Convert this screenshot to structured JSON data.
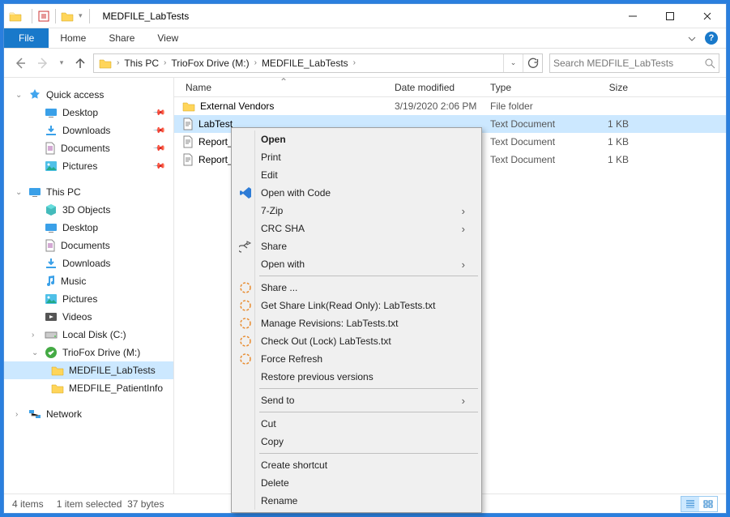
{
  "window": {
    "title": "MEDFILE_LabTests"
  },
  "ribbon": {
    "file": "File",
    "home": "Home",
    "share": "Share",
    "view": "View"
  },
  "breadcrumb": {
    "thispc": "This PC",
    "drive": "TrioFox Drive (M:)",
    "folder": "MEDFILE_LabTests"
  },
  "search": {
    "placeholder": "Search MEDFILE_LabTests"
  },
  "columns": {
    "name": "Name",
    "date": "Date modified",
    "type": "Type",
    "size": "Size"
  },
  "sidebar": {
    "quick_access": "Quick access",
    "desktop": "Desktop",
    "downloads": "Downloads",
    "documents": "Documents",
    "pictures": "Pictures",
    "this_pc": "This PC",
    "objects3d": "3D Objects",
    "desktop2": "Desktop",
    "documents2": "Documents",
    "downloads2": "Downloads",
    "music": "Music",
    "pictures2": "Pictures",
    "videos": "Videos",
    "localdisk": "Local Disk (C:)",
    "triofox": "TrioFox Drive (M:)",
    "medfile_lab": "MEDFILE_LabTests",
    "medfile_patient": "MEDFILE_PatientInfo",
    "network": "Network"
  },
  "files": [
    {
      "name": "External Vendors",
      "date": "3/19/2020 2:06 PM",
      "type": "File folder",
      "size": "",
      "icon": "folder"
    },
    {
      "name": "LabTests.txt",
      "date": "",
      "type": "Text Document",
      "size": "1 KB",
      "icon": "text",
      "selected": true,
      "name_display": "LabTest"
    },
    {
      "name": "Report_",
      "date": "",
      "type": "Text Document",
      "size": "1 KB",
      "icon": "text"
    },
    {
      "name": "Report_",
      "date": "",
      "type": "Text Document",
      "size": "1 KB",
      "icon": "text"
    }
  ],
  "status": {
    "items": "4 items",
    "selected": "1 item selected",
    "bytes": "37 bytes"
  },
  "menu": {
    "open": "Open",
    "print": "Print",
    "edit": "Edit",
    "open_with_code": "Open with Code",
    "seven_zip": "7-Zip",
    "crc_sha": "CRC SHA",
    "share_sys": "Share",
    "open_with": "Open with",
    "share_ellipsis": "Share ...",
    "get_share_link": "Get Share Link(Read Only): LabTests.txt",
    "manage_revisions": "Manage Revisions: LabTests.txt",
    "check_out": "Check Out (Lock) LabTests.txt",
    "force_refresh": "Force Refresh",
    "restore_versions": "Restore previous versions",
    "send_to": "Send to",
    "cut": "Cut",
    "copy": "Copy",
    "create_shortcut": "Create shortcut",
    "delete": "Delete",
    "rename": "Rename"
  }
}
